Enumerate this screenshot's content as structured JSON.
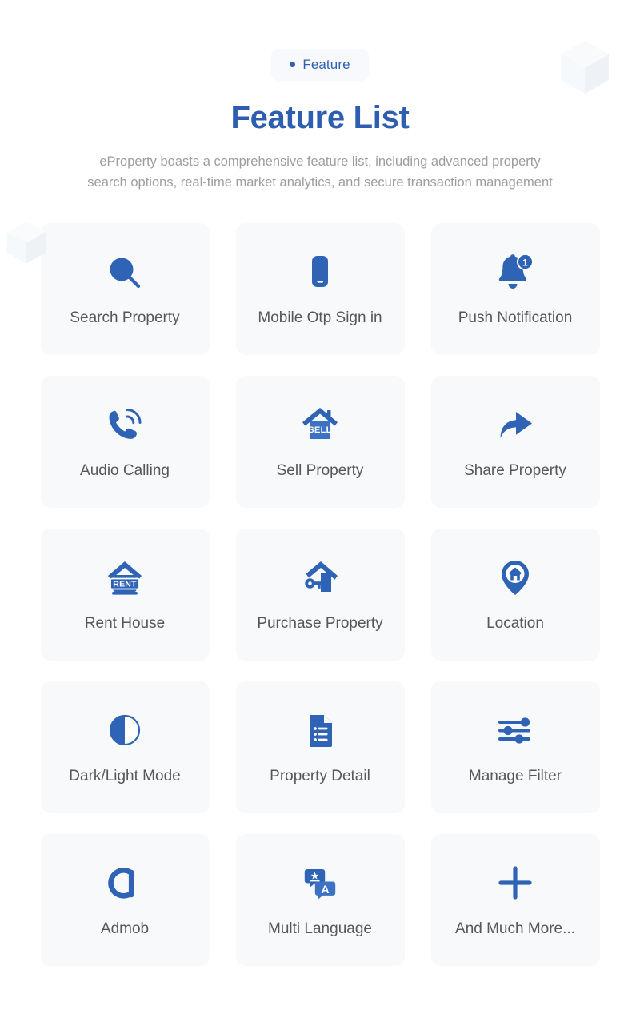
{
  "header": {
    "badge_label": "Feature",
    "badge_dot": "bullet-dot",
    "title": "Feature List",
    "subtitle": "eProperty boasts a comprehensive feature list, including advanced property search options, real-time market analytics, and secure transaction management"
  },
  "colors": {
    "accent": "#2d5eb0",
    "icon": "#2f63b5",
    "card_bg": "#f8f9fb",
    "badge_bg": "#f7f9fc",
    "label_text": "#575757",
    "subtitle_text": "#9d9d9d",
    "decoration": "#f2f5f9"
  },
  "decorations": [
    {
      "name": "cube-top-right"
    },
    {
      "name": "cube-mid-left"
    }
  ],
  "features": [
    {
      "label": "Search Property",
      "icon": "search-icon"
    },
    {
      "label": "Mobile Otp Sign in",
      "icon": "mobile-phone-icon"
    },
    {
      "label": "Push Notification",
      "icon": "bell-notification-icon",
      "badge": "1"
    },
    {
      "label": "Audio Calling",
      "icon": "phone-call-icon"
    },
    {
      "label": "Sell Property",
      "icon": "house-sell-icon",
      "sign_text": "SELL"
    },
    {
      "label": "Share Property",
      "icon": "share-arrow-icon"
    },
    {
      "label": "Rent House",
      "icon": "house-rent-icon",
      "sign_text": "RENT"
    },
    {
      "label": "Purchase Property",
      "icon": "house-key-icon"
    },
    {
      "label": "Location",
      "icon": "map-pin-house-icon"
    },
    {
      "label": "Dark/Light Mode",
      "icon": "half-circle-contrast-icon"
    },
    {
      "label": "Property Detail",
      "icon": "document-list-icon"
    },
    {
      "label": "Manage Filter",
      "icon": "filter-sliders-icon"
    },
    {
      "label": "Admob",
      "icon": "admob-icon"
    },
    {
      "label": "Multi Language",
      "icon": "translate-icon",
      "glyph": "A"
    },
    {
      "label": "And Much More...",
      "icon": "plus-icon"
    }
  ]
}
